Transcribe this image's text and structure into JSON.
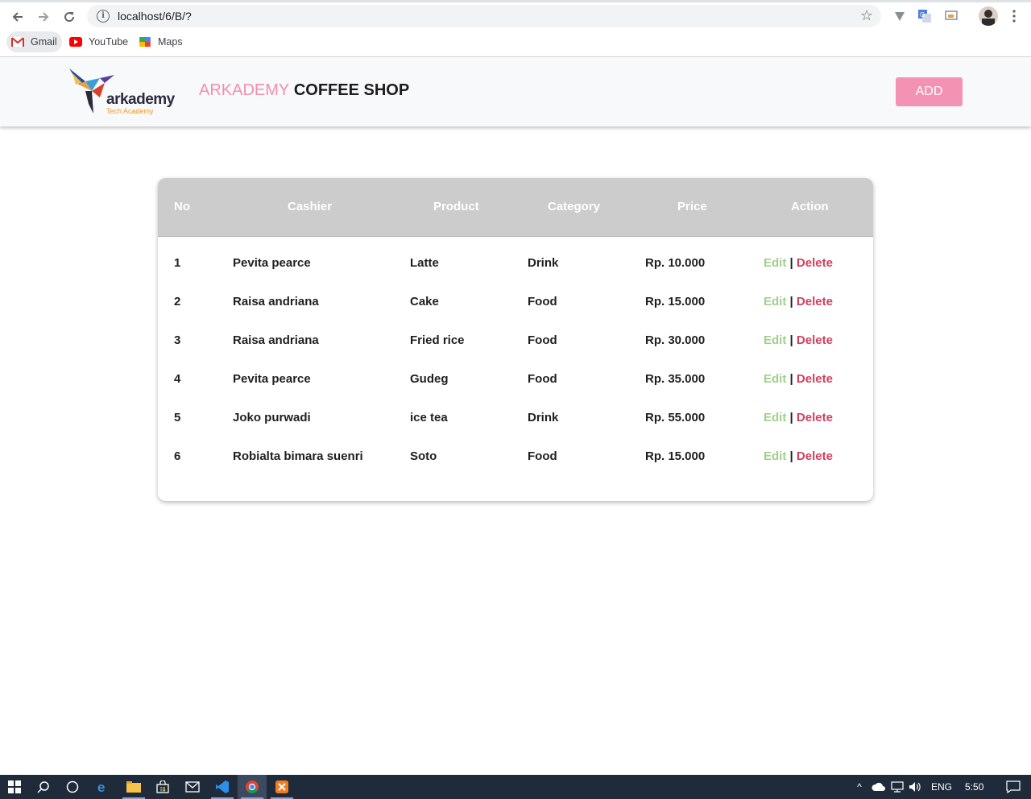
{
  "browser": {
    "url": "localhost/6/B/?",
    "bookmarks": [
      {
        "label": "Gmail",
        "icon": "gmail-icon"
      },
      {
        "label": "YouTube",
        "icon": "youtube-icon"
      },
      {
        "label": "Maps",
        "icon": "maps-icon"
      }
    ]
  },
  "header": {
    "logo_text": "arkademy",
    "logo_subtext": "Tech Academy",
    "brand_accent": "ARKADEMY",
    "brand_main": "COFFEE SHOP",
    "add_label": "ADD",
    "accent_color": "#f492b4"
  },
  "table": {
    "columns": [
      "No",
      "Cashier",
      "Product",
      "Category",
      "Price",
      "Action"
    ],
    "rows": [
      {
        "no": "1",
        "cashier": "Pevita pearce",
        "product": "Latte",
        "category": "Drink",
        "price": "Rp. 10.000"
      },
      {
        "no": "2",
        "cashier": "Raisa andriana",
        "product": "Cake",
        "category": "Food",
        "price": "Rp. 15.000"
      },
      {
        "no": "3",
        "cashier": "Raisa andriana",
        "product": "Fried rice",
        "category": "Food",
        "price": "Rp. 30.000"
      },
      {
        "no": "4",
        "cashier": "Pevita pearce",
        "product": "Gudeg",
        "category": "Food",
        "price": "Rp. 35.000"
      },
      {
        "no": "5",
        "cashier": "Joko purwadi",
        "product": "ice tea",
        "category": "Drink",
        "price": "Rp. 55.000"
      },
      {
        "no": "6",
        "cashier": "Robialta bimara suenri",
        "product": "Soto",
        "category": "Food",
        "price": "Rp. 15.000"
      }
    ],
    "edit_label": "Edit",
    "separator": "|",
    "delete_label": "Delete"
  },
  "taskbar": {
    "language": "ENG",
    "time": "5:50"
  }
}
